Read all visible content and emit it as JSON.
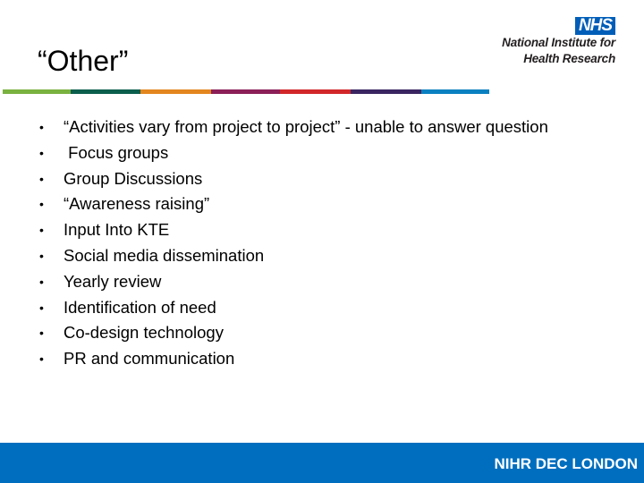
{
  "slide": {
    "title": "“Other”",
    "color_bar": [
      {
        "name": "green",
        "color": "#7ab23f"
      },
      {
        "name": "dark-green",
        "color": "#0b5e4c"
      },
      {
        "name": "orange",
        "color": "#e3861f"
      },
      {
        "name": "maroon",
        "color": "#8c1f57"
      },
      {
        "name": "red",
        "color": "#d2272a"
      },
      {
        "name": "dark-purple",
        "color": "#3a2561"
      },
      {
        "name": "blue",
        "color": "#0a80c0"
      }
    ],
    "logo": {
      "nhs": "NHS",
      "line1": "National Institute for",
      "line2": "Health Research",
      "nhs_color": "#005eb8"
    },
    "bullet_symbol": "•",
    "bullets": [
      "“Activities vary from project to project” - unable to answer question",
      " Focus groups",
      "Group Discussions",
      "“Awareness raising”",
      "Input Into KTE",
      "Social media dissemination",
      "Yearly review",
      "Identification of need",
      "Co-design technology",
      "PR and communication"
    ],
    "footer": {
      "text": "NIHR DEC LONDON",
      "color": "#006ebf"
    }
  }
}
